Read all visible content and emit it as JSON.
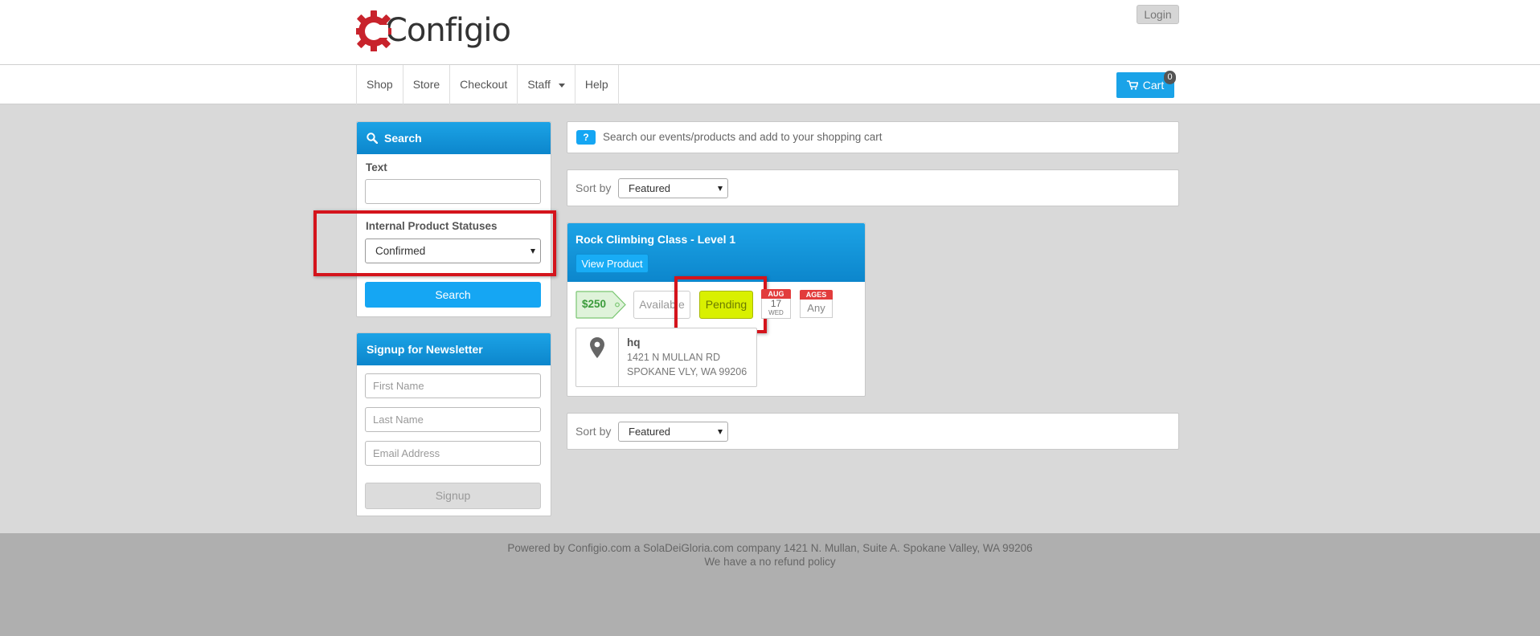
{
  "header": {
    "logo_text": "Configio",
    "login_label": "Login"
  },
  "nav": {
    "items": [
      {
        "label": "Shop"
      },
      {
        "label": "Store"
      },
      {
        "label": "Checkout"
      },
      {
        "label": "Staff"
      },
      {
        "label": "Help"
      }
    ],
    "cart_label": "Cart",
    "cart_count": "0"
  },
  "search_panel": {
    "title": "Search",
    "text_label": "Text",
    "text_value": "",
    "status_label": "Internal Product Statuses",
    "status_value": "Confirmed",
    "search_button": "Search"
  },
  "newsletter": {
    "title": "Signup for Newsletter",
    "first_name_placeholder": "First Name",
    "last_name_placeholder": "Last Name",
    "email_placeholder": "Email Address",
    "signup_button": "Signup"
  },
  "info_bar": {
    "badge": "?",
    "text": "Search our events/products and add to your shopping cart"
  },
  "sort_top": {
    "label": "Sort by",
    "value": "Featured"
  },
  "sort_bottom": {
    "label": "Sort by",
    "value": "Featured"
  },
  "product": {
    "title": "Rock Climbing Class - Level 1",
    "view_button": "View Product",
    "price": "$250",
    "availability": "Available",
    "status": "Pending",
    "date_month": "AUG",
    "date_day": "17",
    "date_weekday": "WED",
    "ages_label": "AGES",
    "ages_value": "Any",
    "location_name": "hq",
    "address_line1": "1421 N MULLAN RD",
    "address_line2": "SPOKANE VLY, WA 99206"
  },
  "footer": {
    "line1": "Powered by Configio.com a SolaDeiGloria.com company 1421 N. Mullan, Suite A. Spokane Valley, WA 99206",
    "line2": "We have a no refund policy"
  },
  "colors": {
    "accent_blue": "#15a6f3",
    "header_blue": "#0c86cc",
    "highlight_red": "#d4141c",
    "pending_yellow": "#d9f000",
    "price_green": "#3b9b3b"
  },
  "icons": [
    "gear-logo-icon",
    "search-icon",
    "cart-icon",
    "map-pin-icon",
    "question-icon"
  ]
}
